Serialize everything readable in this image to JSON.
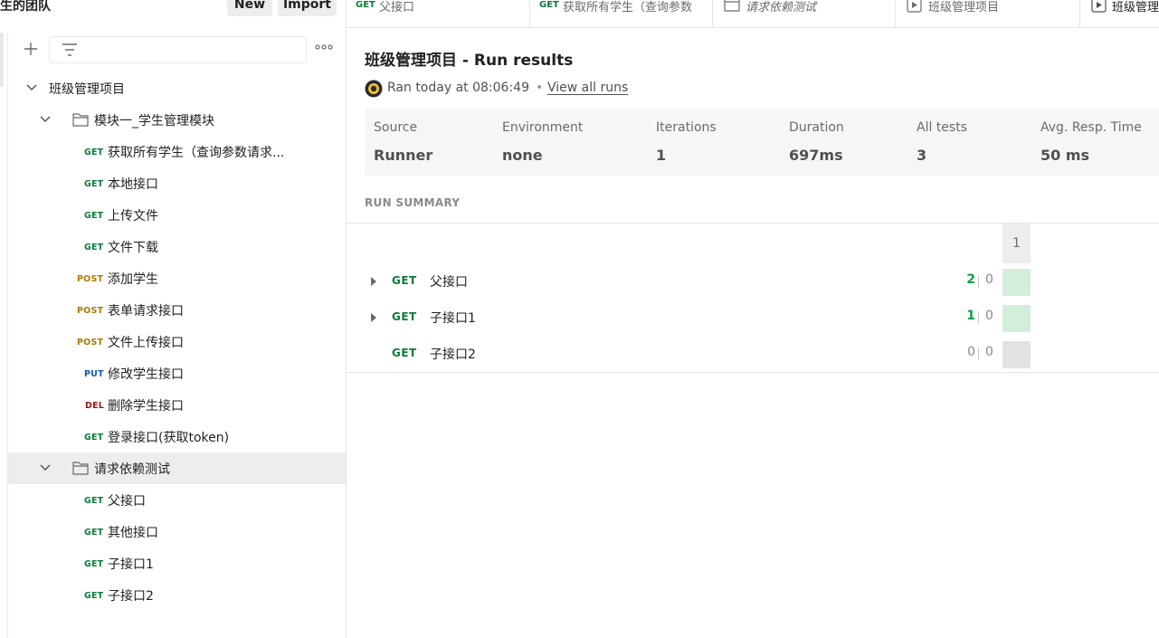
{
  "sidebar": {
    "team": "生的团队",
    "new_label": "New",
    "import_label": "Import",
    "collection": {
      "name": "班级管理项目"
    },
    "folders": [
      {
        "name": "模块一_学生管理模块",
        "requests": [
          {
            "method": "GET",
            "name": "获取所有学生（查询参数请求..."
          },
          {
            "method": "GET",
            "name": "本地接口"
          },
          {
            "method": "GET",
            "name": "上传文件"
          },
          {
            "method": "GET",
            "name": "文件下载"
          }
        ]
      },
      {
        "name": "请求依赖测试",
        "requests": [
          {
            "method": "GET",
            "name": "父接口"
          },
          {
            "method": "GET",
            "name": "其他接口"
          },
          {
            "method": "GET",
            "name": "子接口1"
          },
          {
            "method": "GET",
            "name": "子接口2"
          }
        ]
      }
    ],
    "loose_requests": [
      {
        "method": "POST",
        "name": "添加学生"
      },
      {
        "method": "POST",
        "name": "表单请求接口"
      },
      {
        "method": "POST",
        "name": "文件上传接口"
      },
      {
        "method": "PUT",
        "name": "修改学生接口"
      },
      {
        "method": "DEL",
        "name": "删除学生接口"
      },
      {
        "method": "GET",
        "name": "登录接口(获取token)"
      }
    ]
  },
  "tabs": [
    {
      "method": "GET",
      "label": "父接口"
    },
    {
      "method": "GET",
      "label": "获取所有学生（查询参数"
    },
    {
      "method": "",
      "label": "请求依赖测试",
      "icon": "folder-icon"
    },
    {
      "method": "",
      "label": "班级管理项目",
      "icon": "runner-icon"
    },
    {
      "method": "",
      "label": "班级管理项目",
      "icon": "runner-icon"
    }
  ],
  "main": {
    "title": "班级管理项目 - Run results",
    "ran_text": "Ran today at 08:06:49",
    "dot": "•",
    "view_all_runs": "View all runs",
    "stats": [
      {
        "label": "Source",
        "value": "Runner"
      },
      {
        "label": "Environment",
        "value": "none"
      },
      {
        "label": "Iterations",
        "value": "1"
      },
      {
        "label": "Duration",
        "value": "697ms"
      },
      {
        "label": "All tests",
        "value": "3"
      },
      {
        "label": "Avg. Resp. Time",
        "value": "50 ms"
      }
    ],
    "summary_title": "RUN SUMMARY",
    "iteration_header": "1",
    "rows": [
      {
        "method": "GET",
        "name": "父接口",
        "passed": "2",
        "failed": "0",
        "expandable": true,
        "status": "pass"
      },
      {
        "method": "GET",
        "name": "子接口1",
        "passed": "1",
        "failed": "0",
        "expandable": true,
        "status": "pass"
      },
      {
        "method": "GET",
        "name": "子接口2",
        "passed": "0",
        "failed": "0",
        "expandable": false,
        "status": "none"
      }
    ]
  },
  "colors": {
    "get": "#0b7a3b",
    "post": "#ad7a03",
    "put": "#0b5bb5",
    "del": "#8e1a10",
    "pass_cell": "#d4eedc",
    "none_cell": "#e2e2e2"
  }
}
